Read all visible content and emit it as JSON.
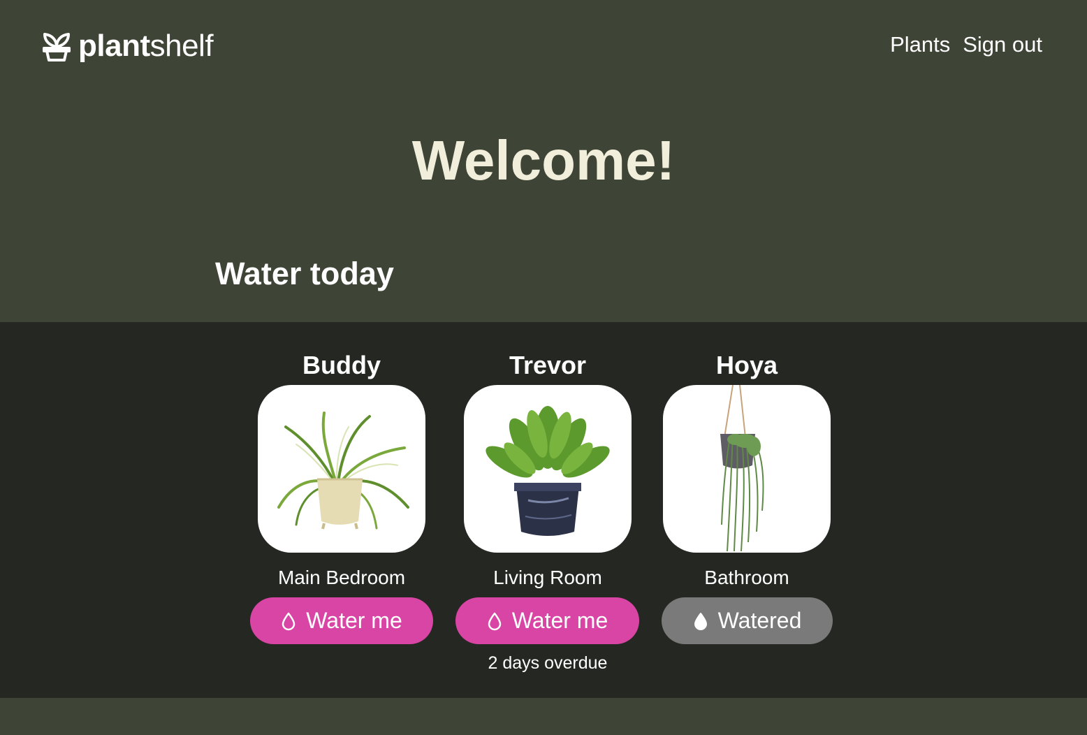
{
  "header": {
    "logo_bold": "plant",
    "logo_light": "shelf",
    "logo_icon": "sprout-pot-icon",
    "nav": [
      {
        "label": "Plants"
      },
      {
        "label": "Sign out"
      }
    ]
  },
  "main": {
    "welcome": "Welcome!",
    "section_title": "Water today"
  },
  "plants": [
    {
      "name": "Buddy",
      "room": "Main Bedroom",
      "button_label": "Water me",
      "button_icon": "water-drop-outline-icon",
      "status": "needs-water",
      "note": ""
    },
    {
      "name": "Trevor",
      "room": "Living Room",
      "button_label": "Water me",
      "button_icon": "water-drop-outline-icon",
      "status": "needs-water",
      "note": "2 days overdue"
    },
    {
      "name": "Hoya",
      "room": "Bathroom",
      "button_label": "Watered",
      "button_icon": "water-drop-filled-icon",
      "status": "watered",
      "note": ""
    }
  ],
  "colors": {
    "page_background": "#3e4436",
    "band_background": "#252822",
    "welcome_text": "#f1eedb",
    "water_button": "#d845a4",
    "watered_button": "#7a7a7a"
  }
}
